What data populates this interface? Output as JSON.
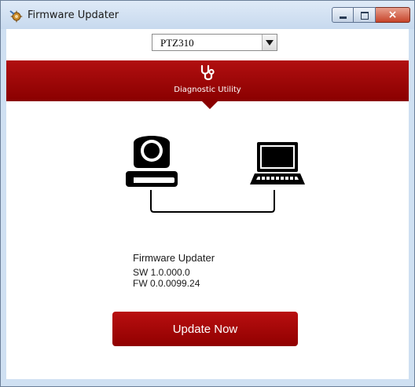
{
  "window": {
    "title": "Firmware Updater",
    "close_glyph": "×"
  },
  "device_select": {
    "value": "PTZ310"
  },
  "banner": {
    "label": "Diagnostic Utility",
    "icon": "stethoscope-icon",
    "color": "#9b0000"
  },
  "diagram": {
    "left_device_icon": "ptz-camera-icon",
    "right_device_icon": "laptop-icon"
  },
  "info": {
    "title": "Firmware Updater",
    "sw_version": "SW 1.0.000.0",
    "fw_version": "FW 0.0.0099.24"
  },
  "actions": {
    "update_label": "Update Now",
    "update_color": "#a80000"
  }
}
